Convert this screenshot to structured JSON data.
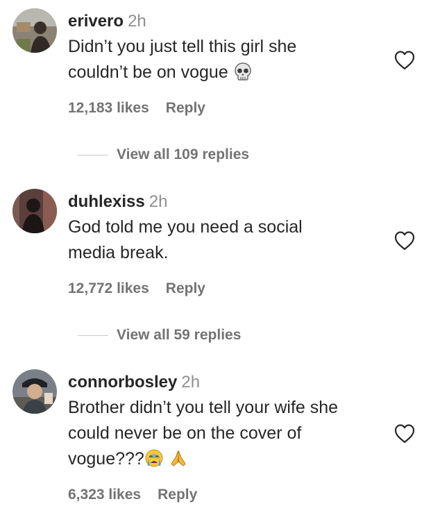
{
  "comments": [
    {
      "username": "erivero",
      "time": "2h",
      "text_lines": [
        "Didn’t you just tell this girl she",
        "couldn’t be on vogue"
      ],
      "emoji_icons": [
        "skull-emoji-icon"
      ],
      "likes": "12,183 likes",
      "reply_label": "Reply",
      "view_replies": "View all 109 replies"
    },
    {
      "username": "duhlexiss",
      "time": "2h",
      "text_lines": [
        "God told me you need a social",
        "media break."
      ],
      "likes": "12,772 likes",
      "reply_label": "Reply",
      "view_replies": "View all 59 replies"
    },
    {
      "username": "connorbosley",
      "time": "2h",
      "text_lines": [
        "Brother didn’t you tell your wife she",
        "could never be on the cover of",
        "vogue???"
      ],
      "emoji_icons": [
        "crying-face-emoji-icon",
        "folded-hands-emoji-icon"
      ],
      "likes": "6,323 likes",
      "reply_label": "Reply"
    }
  ],
  "icons": {
    "like": "heart-outline-icon"
  },
  "colors": {
    "text": "#262626",
    "secondary": "#8e8e8e",
    "meta": "#737373",
    "divider": "#c7c7c7"
  }
}
